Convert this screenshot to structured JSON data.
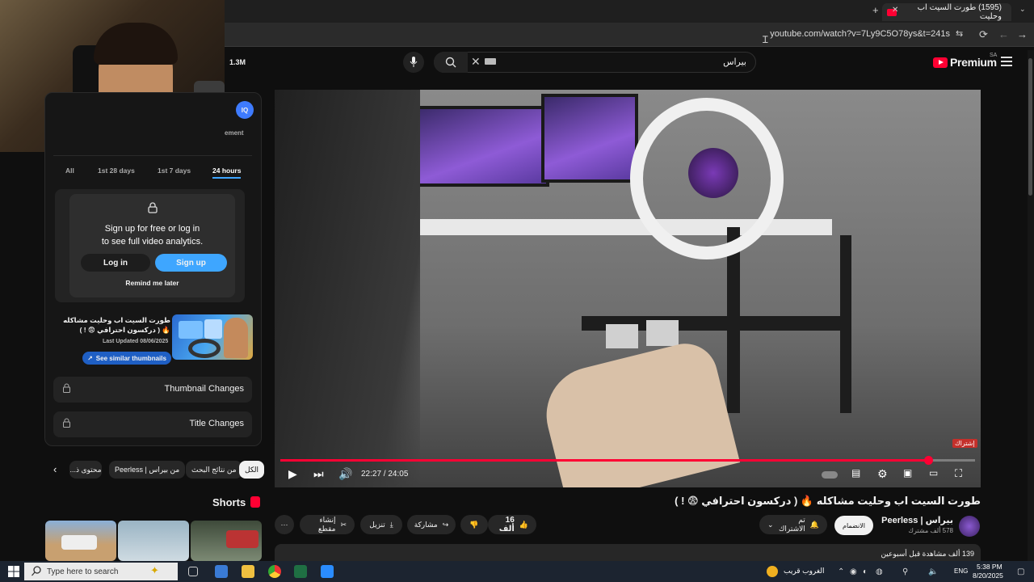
{
  "browser": {
    "tab_title": "(1595) طورت السيت اب وحليت",
    "url": "youtube.com/watch?v=7Ly9C5O78ys&t=241s",
    "new_tab": "+",
    "close_tab": "✕",
    "reload": "⟳",
    "back": "←",
    "forward": "→"
  },
  "youtube": {
    "logo_text": "Premium",
    "region": "SA",
    "search_value": "بيراس",
    "subs_count": "1.3M"
  },
  "player": {
    "time": "22:27 / 24:05",
    "progress": 0.932,
    "subscribe_mark": "إشتراك"
  },
  "video": {
    "title": "طورت السيت اب وحليت مشاكله 🔥 ( دركسون احترافي 😨 ! )",
    "channel_name": "بيراس | Peerless",
    "channel_subs": "578 ألف مشترك",
    "join_label": "الانضمام",
    "subscribed_label": "تم الاشتراك",
    "likes": "16 ألف",
    "share": "مشاركة",
    "download": "تنزيل",
    "clip": "إنشاء مقطع",
    "more": "···",
    "views": "139 ألف مشاهدة قبل أسبوعين"
  },
  "chips": {
    "all": "الكل",
    "search_results": "من نتائج البحث",
    "from_channel": "من بيراس | Peerless",
    "related": "محتوى ذ..."
  },
  "analytics": {
    "partial_tab": "ement",
    "ranges": [
      "All",
      "1st 28 days",
      "1st 7 days",
      "24 hours"
    ],
    "active_range": "24 hours",
    "signup_line1": "Sign up for free or log in",
    "signup_line2": "to see full video analytics.",
    "login": "Log in",
    "signup": "Sign up",
    "remind": "Remind me later",
    "thumb_title": "طورت السيت اب وحليت مشاكله 🔥 ( دركسون احترافي 😨 ! )",
    "last_updated": "Last Updated 08/06/2025",
    "similar_btn": "See similar thumbnails",
    "thumbnail_changes": "Thumbnail Changes",
    "title_changes": "Title Changes"
  },
  "shorts": {
    "title": "Shorts"
  },
  "taskbar": {
    "search_placeholder": "Type here to search",
    "weather": "الغروب قريب",
    "lang": "ENG",
    "time": "5:38 PM",
    "date": "8/20/2025"
  },
  "colors": {
    "accent_red": "#ff0033",
    "accent_blue": "#3ea6ff"
  }
}
